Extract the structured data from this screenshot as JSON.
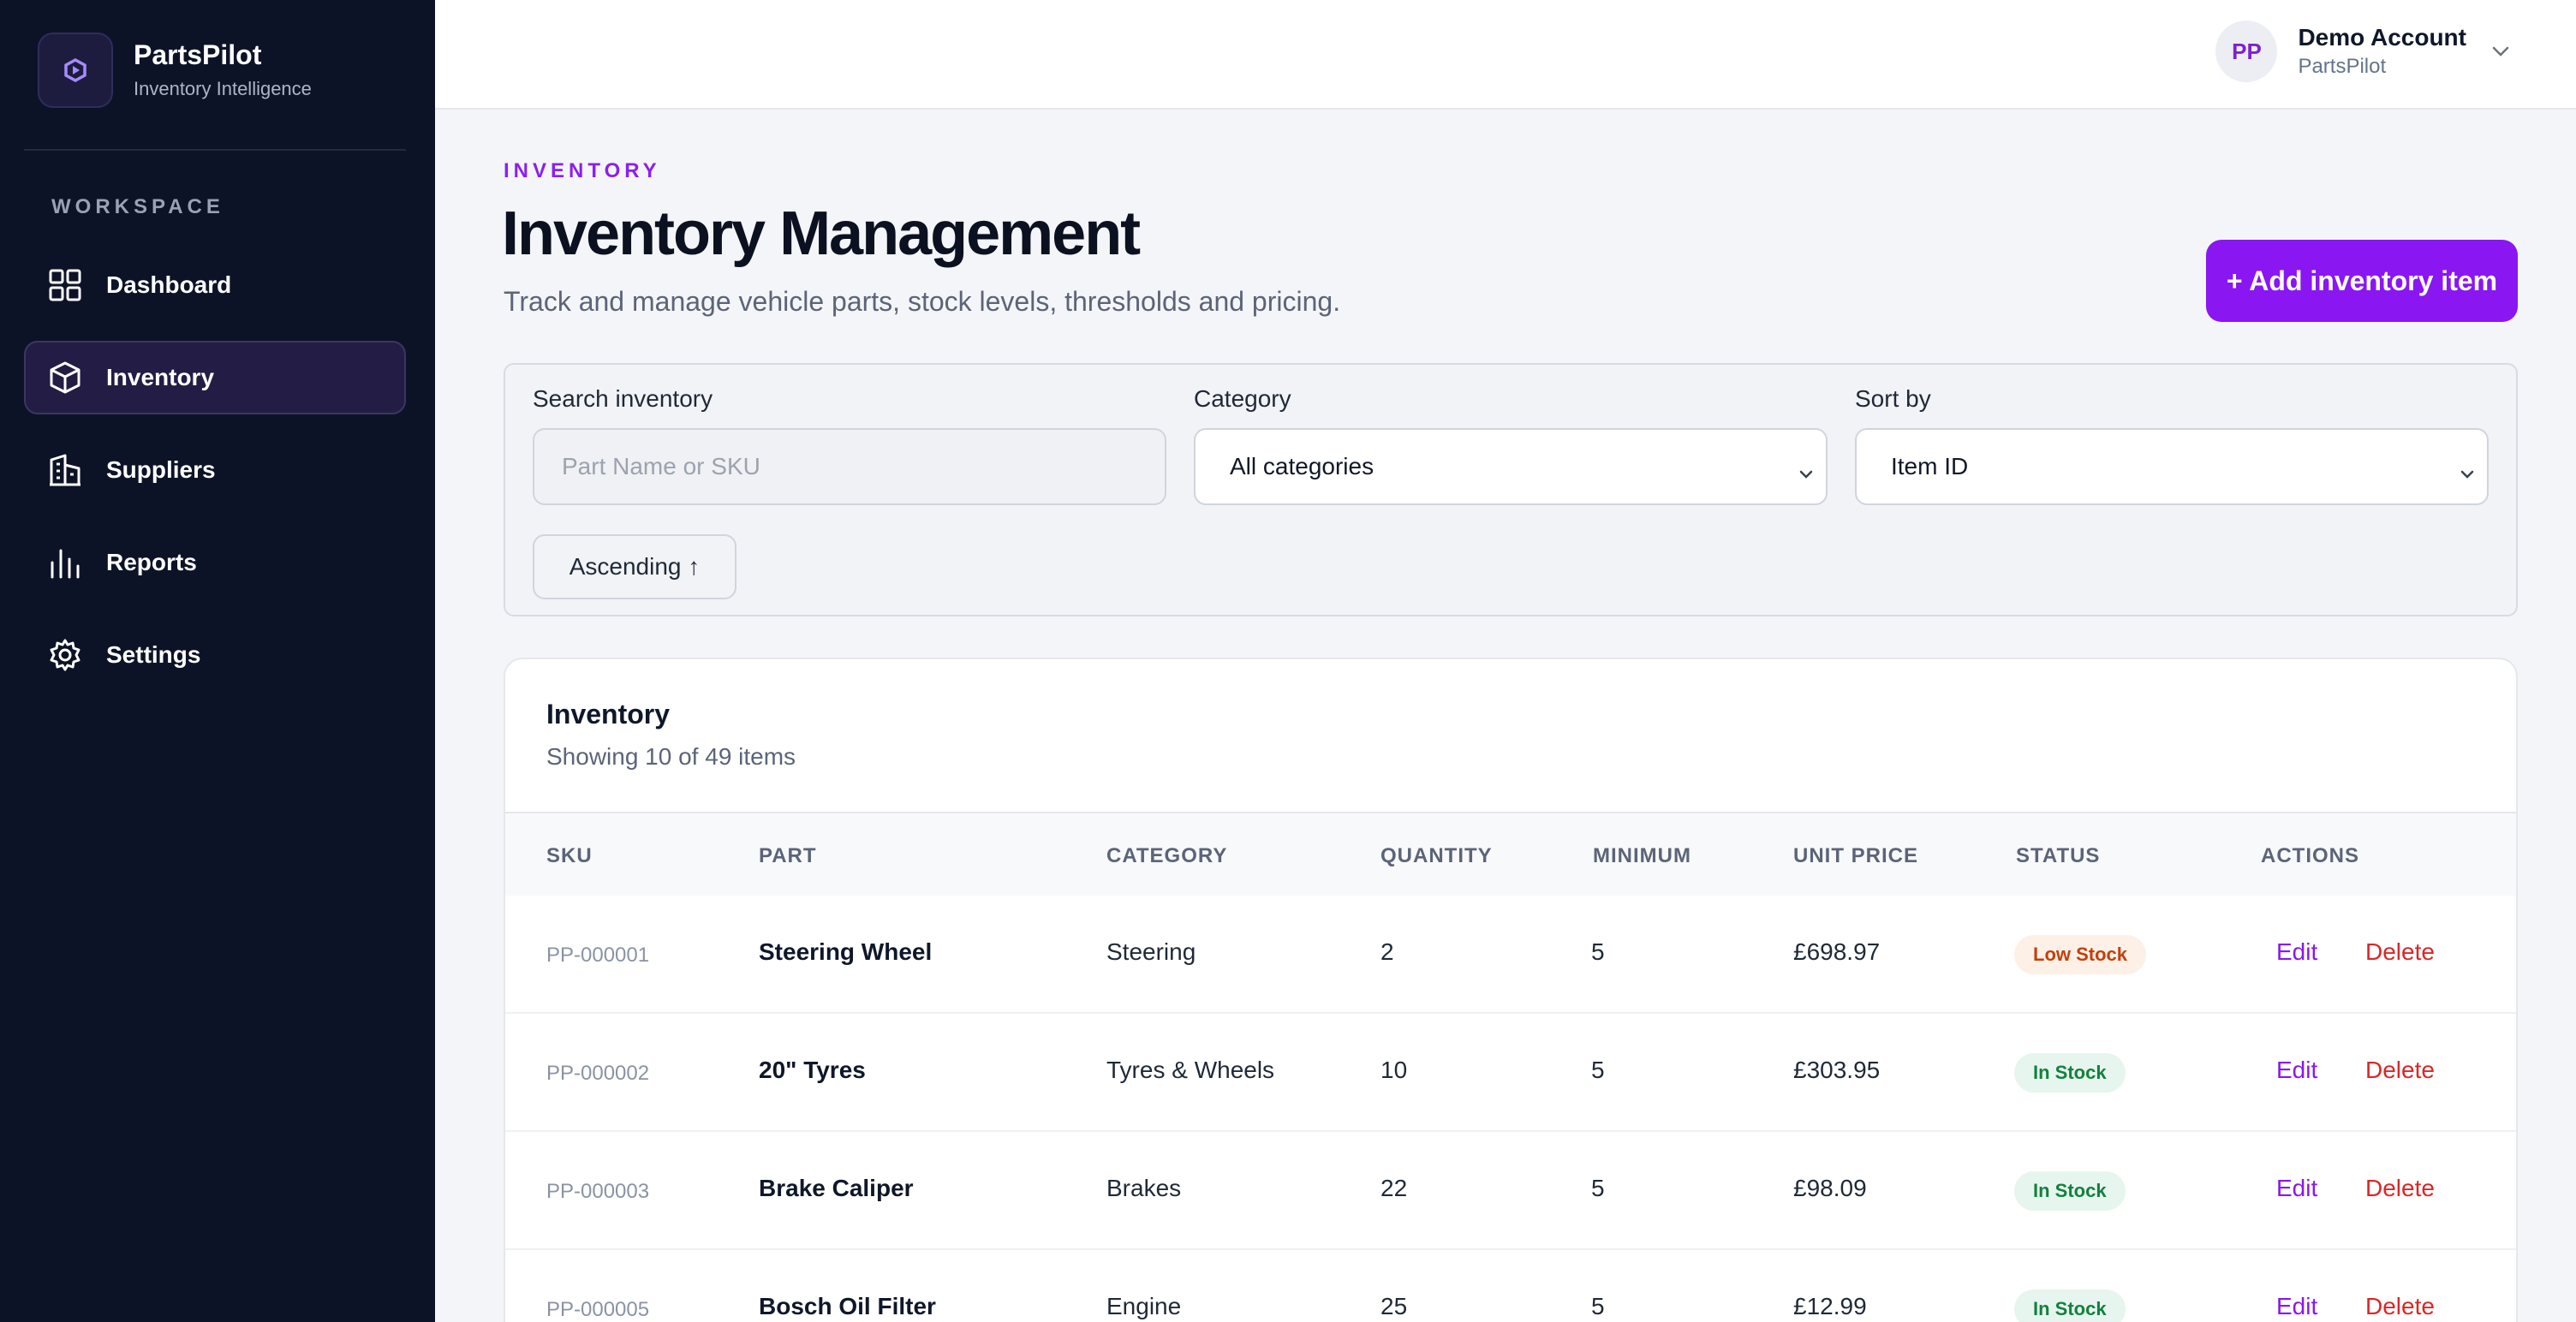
{
  "brand": {
    "name": "PartsPilot",
    "tagline": "Inventory Intelligence"
  },
  "sidebar": {
    "section_label": "WORKSPACE",
    "items": [
      {
        "label": "Dashboard",
        "icon": "grid-icon",
        "active": false
      },
      {
        "label": "Inventory",
        "icon": "box-icon",
        "active": true
      },
      {
        "label": "Suppliers",
        "icon": "building-icon",
        "active": false
      },
      {
        "label": "Reports",
        "icon": "bar-chart-icon",
        "active": false
      },
      {
        "label": "Settings",
        "icon": "gear-icon",
        "active": false
      }
    ]
  },
  "account": {
    "initials": "PP",
    "name": "Demo Account",
    "org": "PartsPilot"
  },
  "page": {
    "eyebrow": "INVENTORY",
    "title": "Inventory Management",
    "subtitle": "Track and manage vehicle parts, stock levels, thresholds and pricing.",
    "add_button": "+ Add inventory item"
  },
  "filters": {
    "search_label": "Search inventory",
    "search_placeholder": "Part Name or SKU",
    "category_label": "Category",
    "category_value": "All categories",
    "sort_label": "Sort by",
    "sort_value": "Item ID",
    "order_button": "Ascending ↑"
  },
  "table": {
    "title": "Inventory",
    "subtitle": "Showing 10 of 49 items",
    "columns": [
      "SKU",
      "PART",
      "CATEGORY",
      "QUANTITY",
      "MINIMUM",
      "UNIT PRICE",
      "STATUS",
      "ACTIONS"
    ],
    "edit_label": "Edit",
    "delete_label": "Delete",
    "rows": [
      {
        "sku": "PP-000001",
        "part": "Steering Wheel",
        "category": "Steering",
        "quantity": "2",
        "minimum": "5",
        "price": "£698.97",
        "status": "Low Stock",
        "status_kind": "low"
      },
      {
        "sku": "PP-000002",
        "part": "20\" Tyres",
        "category": "Tyres & Wheels",
        "quantity": "10",
        "minimum": "5",
        "price": "£303.95",
        "status": "In Stock",
        "status_kind": "in"
      },
      {
        "sku": "PP-000003",
        "part": "Brake Caliper",
        "category": "Brakes",
        "quantity": "22",
        "minimum": "5",
        "price": "£98.09",
        "status": "In Stock",
        "status_kind": "in"
      },
      {
        "sku": "PP-000005",
        "part": "Bosch Oil Filter",
        "category": "Engine",
        "quantity": "25",
        "minimum": "5",
        "price": "£12.99",
        "status": "In Stock",
        "status_kind": "in"
      }
    ]
  },
  "colors": {
    "accent": "#8a16f2",
    "sidebar_bg": "#0d1327",
    "low_stock": "#c2410c",
    "in_stock": "#15803d",
    "delete": "#dc2626"
  }
}
